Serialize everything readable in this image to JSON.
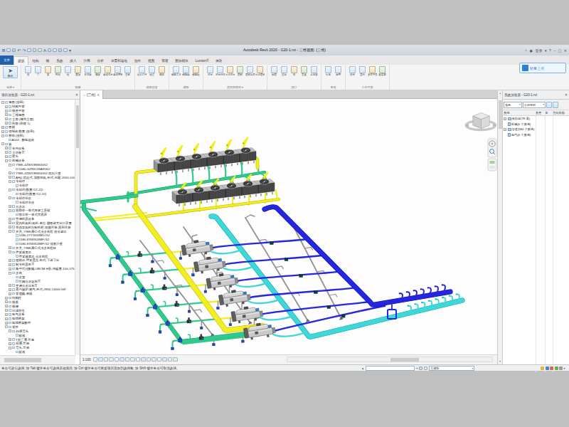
{
  "window": {
    "title": "Autodesk Revit 2020 - G20-1.rvt - 三维视图: {三维}",
    "login": "登录",
    "upload_button": "轻量上传"
  },
  "ribbon": {
    "file_tab": "文件",
    "tabs": [
      "建筑",
      "结构",
      "钢",
      "系统",
      "插入",
      "注释",
      "分析",
      "体量和场地",
      "协作",
      "视图",
      "管理",
      "附加模块",
      "Lumion®",
      "修改"
    ],
    "selected_tab": "建筑",
    "modify_button": "修改",
    "select_group": "选择 ▾",
    "groups": [
      {
        "label": "构建",
        "items": [
          "墙",
          "门",
          "窗",
          "构件",
          "柱",
          "屋顶",
          "天花板",
          "楼板",
          "幕墙系统",
          "幕墙网格",
          "竖梃"
        ]
      },
      {
        "label": "楼梯坡道",
        "items": [
          "栏杆扶手",
          "坡道",
          "楼梯"
        ]
      },
      {
        "label": "模型",
        "items": [
          "模型文字",
          "模型线",
          "模型组"
        ]
      },
      {
        "label": "房间和面积 ▾",
        "items": [
          "房间",
          "房间分隔",
          "标记房间",
          "面积",
          "面积边界",
          "标记面积"
        ]
      },
      {
        "label": "洞口",
        "items": [
          "按面",
          "竖井",
          "墙",
          "垂直",
          "老虎窗"
        ]
      },
      {
        "label": "基准",
        "items": [
          "标高",
          "轴网"
        ]
      },
      {
        "label": "工作平面",
        "items": [
          "设置",
          "显示",
          "参照平面",
          "查看器"
        ]
      }
    ]
  },
  "project_browser": {
    "title": "项目浏览器 - G20-1.rvt",
    "items": [
      [
        0,
        "-",
        "视图 (全部)"
      ],
      [
        1,
        "+",
        "结构平面"
      ],
      [
        1,
        "+",
        "楼层平面"
      ],
      [
        1,
        "+",
        "三维视图"
      ],
      [
        1,
        "+",
        "立面 (建筑立面)"
      ],
      [
        1,
        "+",
        "剖面 (剖面 1)"
      ],
      [
        0,
        "+",
        "图例"
      ],
      [
        0,
        "+",
        "明细表/数量 (全部)"
      ],
      [
        0,
        "-",
        "图纸 (全部)"
      ],
      [
        1,
        "",
        "A104 - 配电箱表"
      ],
      [
        0,
        "-",
        "族"
      ],
      [
        1,
        "+",
        "专用设备"
      ],
      [
        1,
        "+",
        "卫浴装置"
      ],
      [
        1,
        "+",
        "喷头"
      ],
      [
        1,
        "-",
        "机械设备"
      ],
      [
        2,
        "-",
        "Y98K-4ZWX3NW4G52"
      ],
      [
        3,
        "",
        "1080-GZ93C09A9G52"
      ],
      [
        2,
        "+",
        "Y98K-4ZWX3NW4G52 双向注重"
      ],
      [
        2,
        "+",
        "AHU-组合式-顶面回风-卧式-轮毂-2000-10000 CFM"
      ],
      [
        2,
        "-",
        "冷却塔"
      ],
      [
        3,
        "",
        "冷却塔"
      ],
      [
        2,
        "-",
        "冷却塔(数量#12-22)"
      ],
      [
        3,
        "",
        "冷却塔(数量#12-22)"
      ],
      [
        2,
        "-",
        "冷却塔补水"
      ],
      [
        3,
        "",
        "冷却塔补水"
      ],
      [
        2,
        "+",
        "分水器"
      ],
      [
        2,
        "-",
        "双联带一体式混凝土基础"
      ],
      [
        3,
        "",
        "固定带一体式大底座"
      ],
      [
        2,
        "+",
        "空调机房设备"
      ],
      [
        2,
        "+",
        "室内机风机/风机-单位-侧面进大出口容量"
      ],
      [
        2,
        "+",
        "带诱导风机控制机柜-双侧吊装-底部吊装"
      ],
      [
        2,
        "-",
        "开关_Y98K离心式冷水机组 双冷凝器"
      ],
      [
        3,
        "",
        "1080-2YY3053MD#52"
      ],
      [
        3,
        "",
        "1580-87683U3MF#52"
      ],
      [
        3,
        "",
        "1580-87683U3MF#52 双面注重"
      ],
      [
        2,
        "+",
        "开关_Y98K离心式冷水机组M"
      ],
      [
        2,
        "-",
        "弹簧减震器"
      ],
      [
        3,
        "",
        "弹簧减震器-分水机组"
      ],
      [
        2,
        "+",
        "报联器-弹簧悬挂-卧式-下进下出"
      ],
      [
        2,
        "+",
        "制冷机房布置"
      ],
      [
        2,
        "+",
        "集中式分配阀-UROM-H形-传输量-100-175-CN"
      ],
      [
        2,
        "-",
        "水路"
      ],
      [
        3,
        "",
        "水泵"
      ],
      [
        3,
        "",
        "竹网分水箱布置"
      ],
      [
        2,
        "+",
        "空调分水器布置"
      ],
      [
        2,
        "+",
        "蒸汽锅炉-燃气-卧式-2800-14000 kW"
      ],
      [
        2,
        "+",
        "管道阀-单级"
      ],
      [
        1,
        "+",
        "结构柱"
      ],
      [
        1,
        "+",
        "楼板"
      ],
      [
        1,
        "+",
        "楼梯"
      ],
      [
        1,
        "+",
        "过滤符号"
      ],
      [
        1,
        "+",
        "电气设备"
      ],
      [
        1,
        "+",
        "电缆桥架"
      ],
      [
        1,
        "+",
        "电缆桥架配件"
      ],
      [
        1,
        "-",
        "管件"
      ],
      [
        2,
        "-",
        "45度弯头"
      ],
      [
        3,
        "",
        "标准"
      ],
      [
        2,
        "+",
        "T形三通-常规"
      ],
      [
        2,
        "+",
        "四通-常规"
      ],
      [
        2,
        "-",
        "弯头-常规"
      ],
      [
        3,
        "",
        "标准"
      ]
    ]
  },
  "view_tab": {
    "label": "{三维}"
  },
  "system_browser": {
    "title": "系统浏览器 - G20-1.rvt",
    "filter1": "系统",
    "filter2": "全部规程",
    "columns": [
      "系统",
      "数量",
      "值",
      "空间名称"
    ],
    "rows": [
      {
        "exp": "+",
        "label": "未指定(78 项)"
      },
      {
        "exp": "",
        "label": "机械(0 个系统)"
      },
      {
        "exp": "+",
        "label": "管道(580 个系统)"
      },
      {
        "exp": "",
        "label": "电气(0 个系统)"
      }
    ]
  },
  "view_controls": {
    "scale": "1:100"
  },
  "status_bar": {
    "hint": "单击可进行选择; 按 Tab 键并单击可选择其他项目; 按 Ctrl 键并单击可将新项目添加到选择集; 按 Shift 键并单击可取消选择。",
    "options_value": "主模型"
  },
  "palette": {
    "pipe_green": "#2fca8c",
    "pipe_green_edge": "#149b62",
    "pipe_yellow": "#f3ee20",
    "pipe_yellow_edge": "#bdb800",
    "pipe_cyan": "#3ed8d8",
    "pipe_cyan_edge": "#0aabab",
    "pipe_blue": "#2526e0",
    "pipe_blue_edge": "#0d0da6",
    "pipe_gray": "#939393",
    "pipe_gray_edge": "#5f5f5f",
    "valve_dark": "#0e3e3e",
    "pump_blue": "#2043c0",
    "equipment_gray": "#c9c9c9",
    "tower_dark": "#3b3b3b"
  }
}
